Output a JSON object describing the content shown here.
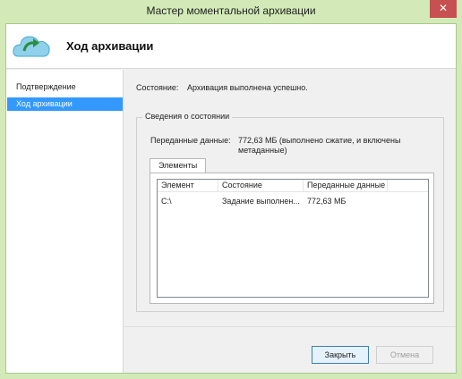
{
  "window": {
    "title": "Мастер моментальной архивации",
    "close_glyph": "✕"
  },
  "header": {
    "title": "Ход архивации",
    "icon": "cloud-backup-icon"
  },
  "sidebar": {
    "items": [
      {
        "label": "Подтверждение",
        "active": false
      },
      {
        "label": "Ход архивации",
        "active": true
      }
    ]
  },
  "status": {
    "label": "Состояние:",
    "value": "Архивация выполнена успешно."
  },
  "details": {
    "legend": "Сведения о состоянии",
    "transferred_label": "Переданные данные:",
    "transferred_value": "772,63 МБ (выполнено сжатие, и включены метаданные)"
  },
  "items_tab": {
    "label": "Элементы",
    "columns": [
      "Элемент",
      "Состояние",
      "Переданные данные"
    ],
    "rows": [
      {
        "item": "C:\\",
        "state": "Задание выполнен...",
        "transferred": "772,63 МБ"
      }
    ]
  },
  "buttons": {
    "close_label": "Закрыть",
    "cancel_label": "Отмена"
  },
  "colors": {
    "frame": "#d3eab8",
    "selection": "#3399ff",
    "close_button": "#c75050"
  }
}
